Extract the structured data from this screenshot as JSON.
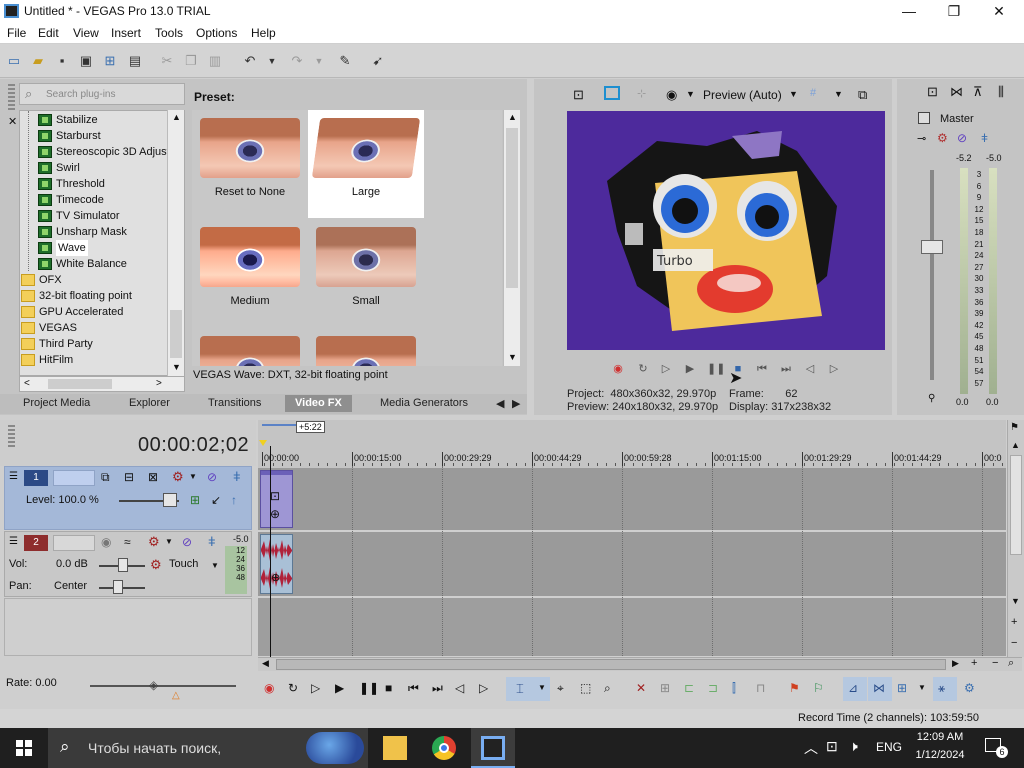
{
  "window": {
    "title": "Untitled * - VEGAS Pro 13.0 TRIAL",
    "minimize": "—",
    "maximize": "❐",
    "close": "✕"
  },
  "menu": [
    "File",
    "Edit",
    "View",
    "Insert",
    "Tools",
    "Options",
    "Help"
  ],
  "plugins": {
    "search_placeholder": "Search plug-ins",
    "tree": [
      {
        "label": "Stabilize",
        "type": "fx"
      },
      {
        "label": "Starburst",
        "type": "fx"
      },
      {
        "label": "Stereoscopic 3D Adjust",
        "type": "fx"
      },
      {
        "label": "Swirl",
        "type": "fx"
      },
      {
        "label": "Threshold",
        "type": "fx"
      },
      {
        "label": "Timecode",
        "type": "fx"
      },
      {
        "label": "TV Simulator",
        "type": "fx"
      },
      {
        "label": "Unsharp Mask",
        "type": "fx"
      },
      {
        "label": "Wave",
        "type": "fx",
        "selected": true
      },
      {
        "label": "White Balance",
        "type": "fx"
      },
      {
        "label": "OFX",
        "type": "folder"
      },
      {
        "label": "32-bit floating point",
        "type": "folder"
      },
      {
        "label": "GPU Accelerated",
        "type": "folder"
      },
      {
        "label": "VEGAS",
        "type": "folder"
      },
      {
        "label": "Third Party",
        "type": "folder"
      },
      {
        "label": "HitFilm",
        "type": "folder"
      }
    ],
    "preset_label": "Preset:",
    "presets": [
      {
        "label": "Reset to None",
        "selected": false
      },
      {
        "label": "Large",
        "selected": true
      },
      {
        "label": "Medium",
        "selected": false
      },
      {
        "label": "Small",
        "selected": false
      }
    ],
    "info": "VEGAS Wave: DXT, 32-bit floating point"
  },
  "tabs": [
    {
      "label": "Project Media",
      "active": false
    },
    {
      "label": "Explorer",
      "active": false
    },
    {
      "label": "Transitions",
      "active": false
    },
    {
      "label": "Video FX",
      "active": true
    },
    {
      "label": "Media Generators",
      "active": false
    }
  ],
  "preview": {
    "mode": "Preview (Auto)",
    "project_label": "Project:",
    "project_value": "480x360x32, 29.970p",
    "preview_label": "Preview:",
    "preview_value": "240x180x32, 29.970p",
    "frame_label": "Frame:",
    "frame_value": "62",
    "display_label": "Display:",
    "display_value": "317x238x32",
    "overlay_text": "Turbo"
  },
  "master": {
    "label": "Master",
    "peak_left": "-5.2",
    "peak_right": "-5.0",
    "scale": [
      "3",
      "6",
      "9",
      "12",
      "15",
      "18",
      "21",
      "24",
      "27",
      "30",
      "33",
      "36",
      "39",
      "42",
      "45",
      "48",
      "51",
      "54",
      "57"
    ],
    "level_left": "0.0",
    "level_right": "0.0"
  },
  "timeline": {
    "timecode": "00:00:02;02",
    "loop_marker": "+5:22",
    "ruler": [
      "00:00:00",
      "00:00:15:00",
      "00:00:29:29",
      "00:00:44:29",
      "00:00:59:28",
      "00:01:15:00",
      "00:01:29:29",
      "00:01:44:29",
      "00:0"
    ],
    "video_track": {
      "number": "1",
      "level_label": "Level: 100.0 %"
    },
    "audio_track": {
      "number": "2",
      "vol_label": "Vol:",
      "vol_value": "0.0 dB",
      "pan_label": "Pan:",
      "pan_value": "Center",
      "mode": "Touch",
      "peak": "-5.0",
      "mini_scale": [
        "12",
        "24",
        "36",
        "48"
      ]
    },
    "rate": "Rate: 0.00"
  },
  "status": {
    "record_time": "Record Time (2 channels): 103:59:50"
  },
  "taskbar": {
    "search_placeholder": "Чтобы начать поиск,",
    "lang": "ENG",
    "time": "12:09 AM",
    "date": "1/12/2024",
    "notifications": "6"
  },
  "colors": {
    "video_bg": "#4d2a9c",
    "track_video": "#a4b8d8",
    "accent": "#4a8fd1"
  }
}
